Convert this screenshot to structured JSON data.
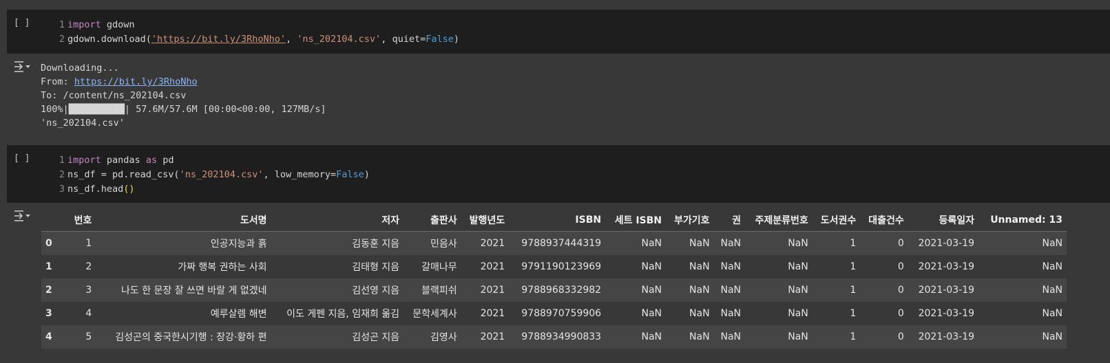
{
  "cell1": {
    "run_label": "[ ]",
    "lines": [
      {
        "num": "1",
        "kw": "import",
        "rest": " gdown"
      },
      {
        "num": "2",
        "pre": "gdown.download(",
        "url": "'https://bit.ly/3RhoNho'",
        "mid": ", ",
        "str": "'ns_202104.csv'",
        "post": ", quiet=",
        "const": "False",
        "end": ")"
      }
    ]
  },
  "output1": {
    "line1": "Downloading...",
    "from_label": "From: ",
    "from_url": "https://bit.ly/3RhoNho",
    "to_line": "To: /content/ns_202104.csv",
    "progress_line": "100%|██████████| 57.6M/57.6M [00:00<00:00, 127MB/s]",
    "result": "'ns_202104.csv'"
  },
  "cell2": {
    "run_label": "[ ]",
    "lines": [
      {
        "num": "1",
        "kw": "import",
        "mid": " pandas ",
        "kw2": "as",
        "rest": " pd"
      },
      {
        "num": "2",
        "pre": "ns_df = pd.read_csv(",
        "str": "'ns_202104.csv'",
        "post": ", low_memory=",
        "const": "False",
        "end": ")"
      },
      {
        "num": "3",
        "pre": "ns_df.head",
        "paren": "()"
      }
    ]
  },
  "dataframe": {
    "columns": [
      "",
      "번호",
      "도서명",
      "저자",
      "출판사",
      "발행년도",
      "ISBN",
      "세트 ISBN",
      "부가기호",
      "권",
      "주제분류번호",
      "도서권수",
      "대출건수",
      "등록일자",
      "Unnamed: 13"
    ],
    "rows": [
      [
        "0",
        "1",
        "인공지능과 흙",
        "김동훈 지음",
        "민음사",
        "2021",
        "9788937444319",
        "NaN",
        "NaN",
        "NaN",
        "NaN",
        "1",
        "0",
        "2021-03-19",
        "NaN"
      ],
      [
        "1",
        "2",
        "가짜 행복 권하는 사회",
        "김태형 지음",
        "갈매나무",
        "2021",
        "9791190123969",
        "NaN",
        "NaN",
        "NaN",
        "NaN",
        "1",
        "0",
        "2021-03-19",
        "NaN"
      ],
      [
        "2",
        "3",
        "나도 한 문장 잘 쓰면 바랄 게 없겠네",
        "김선영 지음",
        "블랙피쉬",
        "2021",
        "9788968332982",
        "NaN",
        "NaN",
        "NaN",
        "NaN",
        "1",
        "0",
        "2021-03-19",
        "NaN"
      ],
      [
        "3",
        "4",
        "예루살렘 해변",
        "이도 게펜 지음, 임재희 옮김",
        "문학세계사",
        "2021",
        "9788970759906",
        "NaN",
        "NaN",
        "NaN",
        "NaN",
        "1",
        "0",
        "2021-03-19",
        "NaN"
      ],
      [
        "4",
        "5",
        "김성곤의 중국한시기행 : 장강·황하 편",
        "김성곤 지음",
        "김영사",
        "2021",
        "9788934990833",
        "NaN",
        "NaN",
        "NaN",
        "NaN",
        "1",
        "0",
        "2021-03-19",
        "NaN"
      ]
    ]
  }
}
